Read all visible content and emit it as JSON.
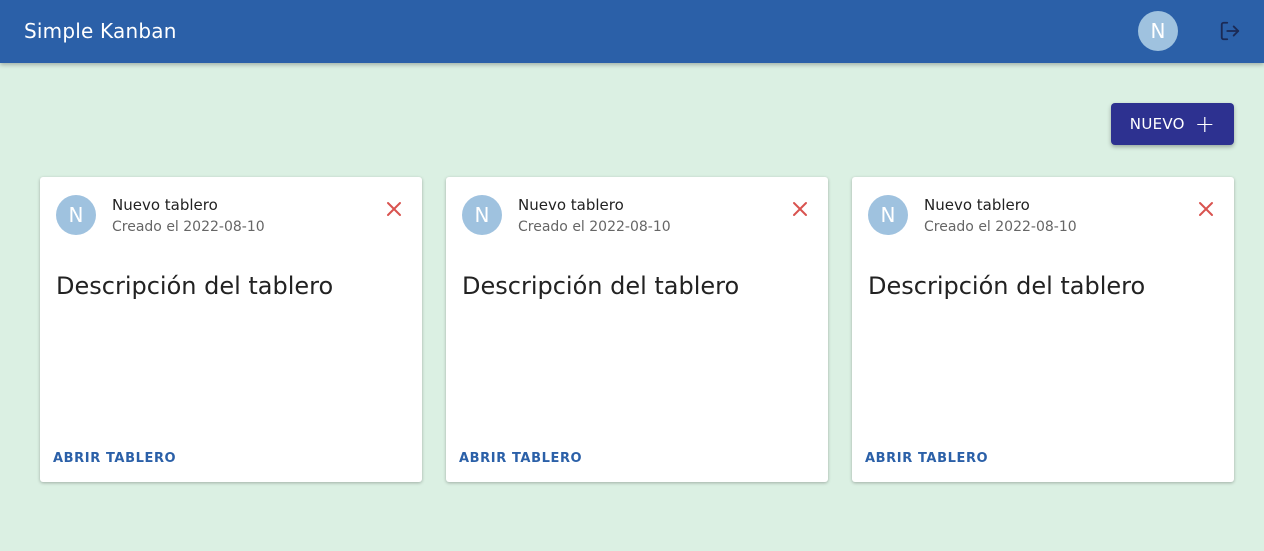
{
  "appbar": {
    "title": "Simple Kanban",
    "avatar_initial": "N",
    "logout_icon": "logout-icon"
  },
  "toolbar": {
    "new_label": "NUEVO",
    "new_icon": "+"
  },
  "boards": [
    {
      "avatar_initial": "N",
      "title": "Nuevo tablero",
      "created": "Creado el 2022-08-10",
      "description": "Descripción del tablero",
      "open_label": "ABRIR TABLERO"
    },
    {
      "avatar_initial": "N",
      "title": "Nuevo tablero",
      "created": "Creado el 2022-08-10",
      "description": "Descripción del tablero",
      "open_label": "ABRIR TABLERO"
    },
    {
      "avatar_initial": "N",
      "title": "Nuevo tablero",
      "created": "Creado el 2022-08-10",
      "description": "Descripción del tablero",
      "open_label": "ABRIR TABLERO"
    }
  ],
  "colors": {
    "appbar": "#2b60a8",
    "background": "#dbf0e3",
    "new_button": "#2d3190",
    "avatar": "#9fc2df",
    "delete_icon": "#d9534f",
    "link": "#2b60a8"
  }
}
